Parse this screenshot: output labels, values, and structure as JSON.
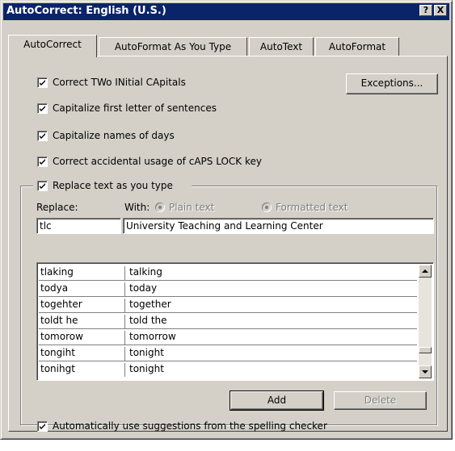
{
  "window": {
    "title": "AutoCorrect: English (U.S.)",
    "help_button": "?",
    "close_button": "X"
  },
  "tabs": [
    {
      "label": "AutoCorrect",
      "active": true
    },
    {
      "label": "AutoFormat As You Type",
      "active": false
    },
    {
      "label": "AutoText",
      "active": false
    },
    {
      "label": "AutoFormat",
      "active": false
    }
  ],
  "options": {
    "correct_two_initial": {
      "label": "Correct TWo INitial CApitals",
      "checked": true
    },
    "capitalize_first": {
      "label": "Capitalize first letter of sentences",
      "checked": true
    },
    "capitalize_days": {
      "label": "Capitalize names of days",
      "checked": true
    },
    "caps_lock": {
      "label": "Correct accidental usage of cAPS LOCK key",
      "checked": true
    },
    "replace_text": {
      "label": "Replace text as you type",
      "checked": true
    }
  },
  "exceptions_button": "Exceptions...",
  "replace": {
    "replace_label": "Replace:",
    "with_label": "With:",
    "plain_text_label": "Plain text",
    "formatted_text_label": "Formatted text",
    "replace_value": "tlc",
    "with_value": "University Teaching and Learning Center"
  },
  "entries": [
    {
      "replace": "tlaking",
      "with": "talking"
    },
    {
      "replace": "todya",
      "with": "today"
    },
    {
      "replace": "togehter",
      "with": "together"
    },
    {
      "replace": "toldt he",
      "with": "told the"
    },
    {
      "replace": "tomorow",
      "with": "tomorrow"
    },
    {
      "replace": "tongiht",
      "with": "tonight"
    },
    {
      "replace": "tonihgt",
      "with": "tonight"
    }
  ],
  "buttons": {
    "add": "Add",
    "delete": "Delete"
  },
  "spelling_suggestions": {
    "label": "Automatically use suggestions from the spelling checker",
    "checked": true
  },
  "icons": {
    "checkbox_check": "check-icon",
    "scroll_up": "arrow-up-icon",
    "scroll_down": "arrow-down-icon"
  }
}
